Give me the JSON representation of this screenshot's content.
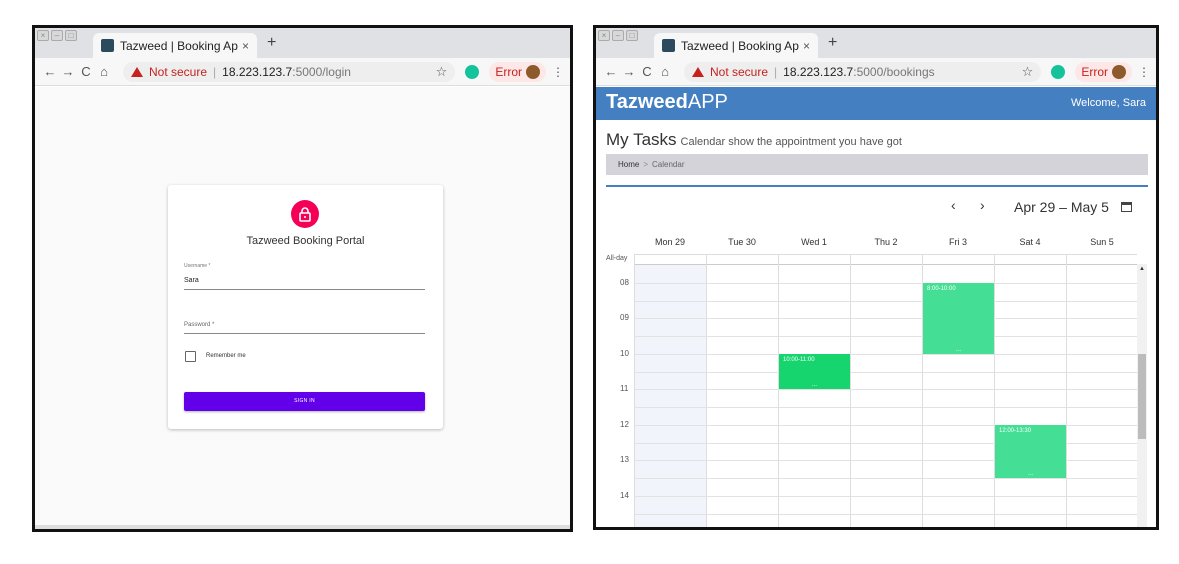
{
  "login_window": {
    "tab_title": "Tazweed | Booking App",
    "tab_close": "×",
    "new_tab": "+",
    "nav": {
      "back": "←",
      "forward": "→",
      "reload": "C",
      "home": "⌂"
    },
    "not_secure": "Not secure",
    "url_host": "18.223.123.7",
    "url_path": ":5000/login",
    "star": "☆",
    "error_label": "Error",
    "menu": "⋮",
    "portal_title": "Tazweed Booking Portal",
    "username_label": "Username *",
    "username_value": "Sara",
    "password_label": "Password *",
    "remember_label": "Remember me",
    "signin_label": "SIGN IN"
  },
  "calendar_window": {
    "tab_title": "Tazweed | Booking App",
    "tab_close": "×",
    "new_tab": "+",
    "nav": {
      "back": "←",
      "forward": "→",
      "reload": "C",
      "home": "⌂"
    },
    "not_secure": "Not secure",
    "url_host": "18.223.123.7",
    "url_path": ":5000/bookings",
    "star": "☆",
    "error_label": "Error",
    "menu": "⋮",
    "brand_bold": "Tazweed",
    "brand_rest": "APP",
    "welcome": "Welcome, Sara",
    "page_title": "My Tasks",
    "page_subtitle": "Calendar show the appointment you have got",
    "breadcrumb_home": "Home",
    "breadcrumb_sep": ">",
    "breadcrumb_current": "Calendar",
    "prev": "‹",
    "next": "›",
    "date_range": "Apr 29 – May 5",
    "days": [
      "Mon 29",
      "Tue 30",
      "Wed 1",
      "Thu 2",
      "Fri 3",
      "Sat 4",
      "Sun 5"
    ],
    "all_day_label": "All-day",
    "hours": [
      "08",
      "09",
      "10",
      "11",
      "12",
      "13",
      "14"
    ],
    "events": [
      {
        "day": "Fri 3",
        "time": "8:00-10:00",
        "start": 8,
        "end": 10
      },
      {
        "day": "Wed 1",
        "time": "10:00-11:00",
        "start": 10,
        "end": 11
      },
      {
        "day": "Sat 4",
        "time": "12:00-13:30",
        "start": 12,
        "end": 13.5
      }
    ],
    "event_more": "...",
    "colors": {
      "appbar": "#437fc1",
      "event": "#44de94",
      "event_active": "#16d56f"
    }
  }
}
